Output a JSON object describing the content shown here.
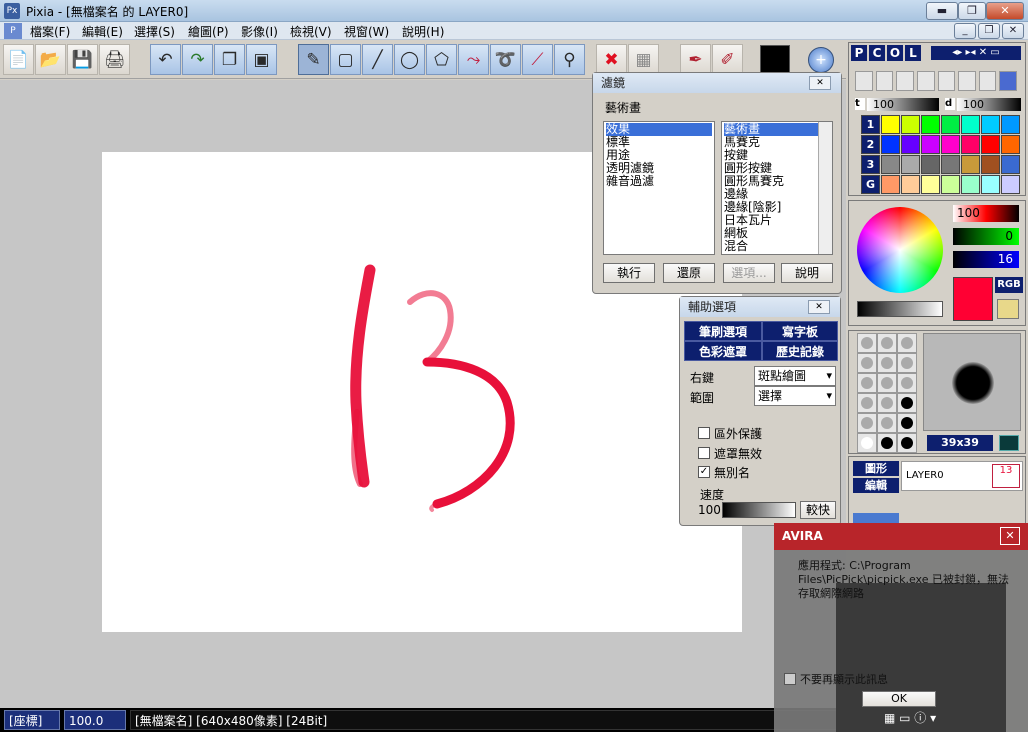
{
  "window": {
    "title": "Pixia - [無檔案名 的 LAYER0]",
    "app_icon": "pixia-app-icon",
    "controls": {
      "minimize": "▬",
      "maximize": "❐",
      "close": "✕"
    }
  },
  "menu": {
    "items": [
      "檔案(F)",
      "編輯(E)",
      "選擇(S)",
      "繪圖(P)",
      "影像(I)",
      "檢視(V)",
      "視窗(W)",
      "說明(H)"
    ],
    "mdi_controls": {
      "minimize": "_",
      "restore": "❐",
      "close": "✕"
    }
  },
  "toolbar": {
    "buttons": [
      {
        "name": "new-file",
        "icon": "📄"
      },
      {
        "name": "open-file",
        "icon": "📂"
      },
      {
        "name": "save-file",
        "icon": "💾"
      },
      {
        "name": "print",
        "icon": "🖨"
      },
      {
        "name": "undo",
        "icon": "↶"
      },
      {
        "name": "redo",
        "icon": "↷"
      },
      {
        "name": "copy",
        "icon": "❐"
      },
      {
        "name": "paste",
        "icon": "▣"
      },
      {
        "name": "pen-tool",
        "icon": "✎"
      },
      {
        "name": "rectangle-tool",
        "icon": "▢"
      },
      {
        "name": "line-tool",
        "icon": "╱"
      },
      {
        "name": "ellipse-tool",
        "icon": "◯"
      },
      {
        "name": "polygon-tool",
        "icon": "⬠"
      },
      {
        "name": "curve-tool",
        "icon": "⤳"
      },
      {
        "name": "lasso-tool",
        "icon": "➰"
      },
      {
        "name": "path-tool",
        "icon": "⟋"
      },
      {
        "name": "stamp-tool",
        "icon": "⚲"
      },
      {
        "name": "clear-selection",
        "icon": "✖"
      },
      {
        "name": "transparency",
        "icon": "▦"
      },
      {
        "name": "brush-pen",
        "icon": "✒"
      },
      {
        "name": "brush-eraser",
        "icon": "✐"
      }
    ],
    "color_swatch": "#000000",
    "zoom_icon": "zoom-icon"
  },
  "status": {
    "coord_label": "[座標]",
    "zoom": "100.0",
    "info": "[無檔案名] [640x480像素] [24Bit]"
  },
  "filter_dialog": {
    "title": "濾鏡",
    "subtitle": "藝術畫",
    "categories": [
      "效果",
      "標準",
      "用途",
      "透明濾鏡",
      "雜音過濾"
    ],
    "effects": [
      "藝術畫",
      "馬賽克",
      "按鍵",
      "圓形按鍵",
      "圓形馬賽克",
      "邊緣",
      "邊緣[陰影]",
      "日本瓦片",
      "網板",
      "混合"
    ],
    "buttons": {
      "run": "執行",
      "reset": "還原",
      "options": "選項...",
      "help": "說明"
    }
  },
  "aux_dialog": {
    "title": "輔助選項",
    "tabs": [
      "筆刷選項",
      "寫字板",
      "色彩遮罩",
      "歷史記錄"
    ],
    "right_click_label": "右鍵",
    "right_click_value": "斑點繪圖",
    "range_label": "範圍",
    "range_value": "選擇",
    "checks": [
      {
        "label": "區外保護",
        "checked": false
      },
      {
        "label": "遮罩無效",
        "checked": false
      },
      {
        "label": "無別名",
        "checked": true
      }
    ],
    "speed_label": "速度",
    "speed_value": "100",
    "speed_button": "較快"
  },
  "palette_panel": {
    "mode_buttons": [
      "P",
      "C",
      "O",
      "L"
    ],
    "size_a": "100",
    "size_b": "100",
    "size_a_tag": "t",
    "size_b_tag": "d",
    "row_labels": [
      "1",
      "2",
      "3",
      "G"
    ],
    "row1": [
      "#ffff00",
      "#ccff00",
      "#00ff00",
      "#00ee44",
      "#00ffcc",
      "#00ccff",
      "#0099ff"
    ],
    "row2": [
      "#0033ff",
      "#6600ff",
      "#cc00ff",
      "#ff00cc",
      "#ff0066",
      "#ff0000",
      "#ff6600"
    ],
    "row3": [
      "#888888",
      "#aaaaaa",
      "#666666",
      "#777777",
      "#c89a3a",
      "#a05020",
      "#3a6ad0"
    ],
    "row4": [
      "#ff9966",
      "#ffcc99",
      "#ffff99",
      "#ccff99",
      "#99ffcc",
      "#99ffff",
      "#ccccff"
    ]
  },
  "color_panel": {
    "r": "100",
    "g": "0",
    "b": "16",
    "mode": "RGB",
    "current_color": "#ff0033"
  },
  "brush_panel": {
    "size": "39x39"
  },
  "layer_panel": {
    "buttons": [
      "圖形",
      "編輯"
    ],
    "layer_name": "LAYER0"
  },
  "avira": {
    "logo": "AVIRA",
    "message": "應用程式: C:\\Program Files\\PicPick\\picpick.exe 已被封鎖，無法存取網際網路",
    "dont_show": "不要再顯示此訊息",
    "ok": "OK"
  }
}
